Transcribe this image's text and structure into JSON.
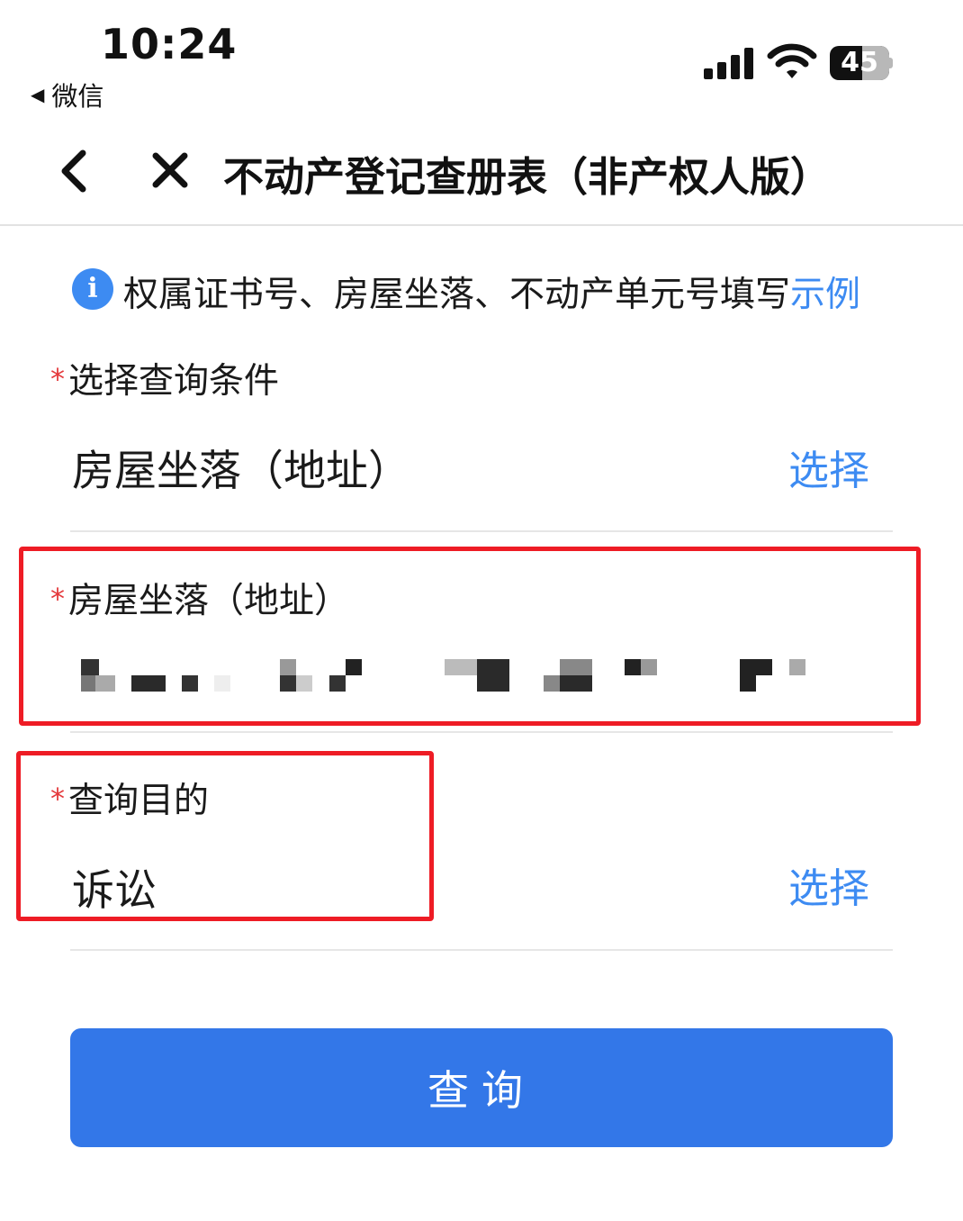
{
  "status_bar": {
    "time": "10:24",
    "back_app": "微信",
    "back_arrow": "◀",
    "battery_level": "45",
    "signal_icon": "cellular-signal-icon",
    "wifi_icon": "wifi-icon"
  },
  "nav": {
    "title": "不动产登记查册表（非产权人版）",
    "back_icon": "chevron-left-icon",
    "close_icon": "close-icon"
  },
  "info": {
    "icon_char": "i",
    "text": "权属证书号、房屋坐落、不动产单元号填写",
    "link": "示例"
  },
  "form": {
    "required_mark": "*",
    "condition": {
      "label": "选择查询条件",
      "value": "房屋坐落（地址）",
      "select_label": "选择"
    },
    "address": {
      "label": "房屋坐落（地址）"
    },
    "purpose": {
      "label": "查询目的",
      "value": "诉讼",
      "select_label": "选择"
    }
  },
  "submit": {
    "label": "查询"
  },
  "colors": {
    "accent": "#3d8bf2",
    "button": "#3377e8",
    "required": "#e4393c",
    "highlight": "#ee1c25"
  }
}
